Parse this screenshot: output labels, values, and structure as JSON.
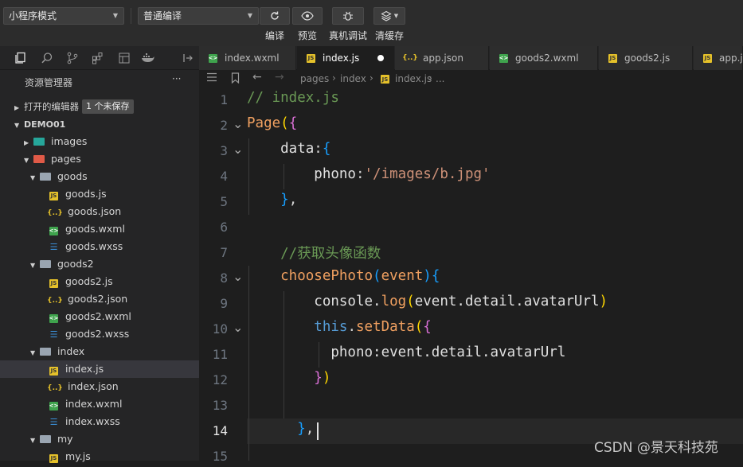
{
  "toolbar": {
    "mode_select": "小程序模式",
    "compile_select": "普通编译",
    "buttons": [
      {
        "label": "编译",
        "icon": "refresh-icon"
      },
      {
        "label": "预览",
        "icon": "eye-icon"
      },
      {
        "label": "真机调试",
        "icon": "bug-icon"
      },
      {
        "label": "清缓存",
        "icon": "layers-icon"
      }
    ]
  },
  "tabs": [
    {
      "label": "index.wxml",
      "type": "wxml"
    },
    {
      "label": "index.js",
      "type": "js",
      "active": true,
      "unsaved": true
    },
    {
      "label": "app.json",
      "type": "json"
    },
    {
      "label": "goods2.wxml",
      "type": "wxml"
    },
    {
      "label": "goods2.js",
      "type": "js"
    },
    {
      "label": "app.js",
      "type": "js"
    }
  ],
  "explorer": {
    "title": "资源管理器",
    "more": "···",
    "open_editors": "打开的编辑器",
    "unsaved_badge": "1 个未保存",
    "project": "DEMO01",
    "tree": [
      {
        "label": "images",
        "kind": "folder",
        "depth": 1,
        "collapsed": true,
        "folder_color": "#26a69a"
      },
      {
        "label": "pages",
        "kind": "folder",
        "depth": 1,
        "folder_color": "#e05a47"
      },
      {
        "label": "goods",
        "kind": "folder",
        "depth": 2
      },
      {
        "label": "goods.js",
        "kind": "js",
        "depth": 3
      },
      {
        "label": "goods.json",
        "kind": "json",
        "depth": 3
      },
      {
        "label": "goods.wxml",
        "kind": "wxml",
        "depth": 3
      },
      {
        "label": "goods.wxss",
        "kind": "wxss",
        "depth": 3
      },
      {
        "label": "goods2",
        "kind": "folder",
        "depth": 2
      },
      {
        "label": "goods2.js",
        "kind": "js",
        "depth": 3
      },
      {
        "label": "goods2.json",
        "kind": "json",
        "depth": 3
      },
      {
        "label": "goods2.wxml",
        "kind": "wxml",
        "depth": 3
      },
      {
        "label": "goods2.wxss",
        "kind": "wxss",
        "depth": 3
      },
      {
        "label": "index",
        "kind": "folder",
        "depth": 2
      },
      {
        "label": "index.js",
        "kind": "js",
        "depth": 3,
        "selected": true
      },
      {
        "label": "index.json",
        "kind": "json",
        "depth": 3
      },
      {
        "label": "index.wxml",
        "kind": "wxml",
        "depth": 3
      },
      {
        "label": "index.wxss",
        "kind": "wxss",
        "depth": 3
      },
      {
        "label": "my",
        "kind": "folder",
        "depth": 2
      },
      {
        "label": "my.js",
        "kind": "js",
        "depth": 3
      }
    ]
  },
  "breadcrumb": [
    "pages",
    "index",
    "index.js",
    "..."
  ],
  "editor": {
    "current_line": 14,
    "lines": [
      {
        "n": 1,
        "tokens": [
          {
            "t": "// index.js",
            "c": "c-com"
          }
        ]
      },
      {
        "n": 2,
        "fold": true,
        "tokens": [
          {
            "t": "Page",
            "c": "c-or"
          },
          {
            "t": "(",
            "c": "c-y"
          },
          {
            "t": "{",
            "c": "c-p"
          }
        ]
      },
      {
        "n": 3,
        "fold": true,
        "tokens": [
          {
            "t": "    data",
            "c": "c-pl"
          },
          {
            "t": ":",
            "c": "c-plain"
          },
          {
            "t": "{",
            "c": "c-b"
          }
        ]
      },
      {
        "n": 4,
        "tokens": [
          {
            "t": "        phono",
            "c": "c-pl"
          },
          {
            "t": ":",
            "c": "c-plain"
          },
          {
            "t": "'/images/b.jpg'",
            "c": "c-str"
          }
        ]
      },
      {
        "n": 5,
        "tokens": [
          {
            "t": "    }",
            "c": "c-b"
          },
          {
            "t": ",",
            "c": "c-plain"
          }
        ]
      },
      {
        "n": 6,
        "tokens": []
      },
      {
        "n": 7,
        "tokens": [
          {
            "t": "    //获取头像函数",
            "c": "c-com"
          }
        ]
      },
      {
        "n": 8,
        "fold": true,
        "tokens": [
          {
            "t": "    choosePhoto",
            "c": "c-or"
          },
          {
            "t": "(",
            "c": "c-b"
          },
          {
            "t": "event",
            "c": "c-or"
          },
          {
            "t": ")",
            "c": "c-b"
          },
          {
            "t": "{",
            "c": "c-b"
          }
        ]
      },
      {
        "n": 9,
        "tokens": [
          {
            "t": "        console.",
            "c": "c-pl"
          },
          {
            "t": "log",
            "c": "c-or"
          },
          {
            "t": "(",
            "c": "c-y"
          },
          {
            "t": "event.detail.avatarUrl",
            "c": "c-pl"
          },
          {
            "t": ")",
            "c": "c-y"
          }
        ]
      },
      {
        "n": 10,
        "fold": true,
        "tokens": [
          {
            "t": "        this",
            "c": "c-kw"
          },
          {
            "t": ".",
            "c": "c-plain"
          },
          {
            "t": "setData",
            "c": "c-or"
          },
          {
            "t": "(",
            "c": "c-y"
          },
          {
            "t": "{",
            "c": "c-p"
          }
        ]
      },
      {
        "n": 11,
        "tokens": [
          {
            "t": "          phono",
            "c": "c-pl"
          },
          {
            "t": ":event.detail.avatarUrl",
            "c": "c-pl"
          }
        ]
      },
      {
        "n": 12,
        "tokens": [
          {
            "t": "        }",
            "c": "c-p"
          },
          {
            "t": ")",
            "c": "c-y"
          }
        ]
      },
      {
        "n": 13,
        "tokens": []
      },
      {
        "n": 14,
        "tokens": [
          {
            "t": "      }",
            "c": "c-b"
          },
          {
            "t": ",",
            "c": "c-plain"
          }
        ]
      },
      {
        "n": 15,
        "tokens": []
      }
    ]
  },
  "watermark": "CSDN @景天科技苑"
}
